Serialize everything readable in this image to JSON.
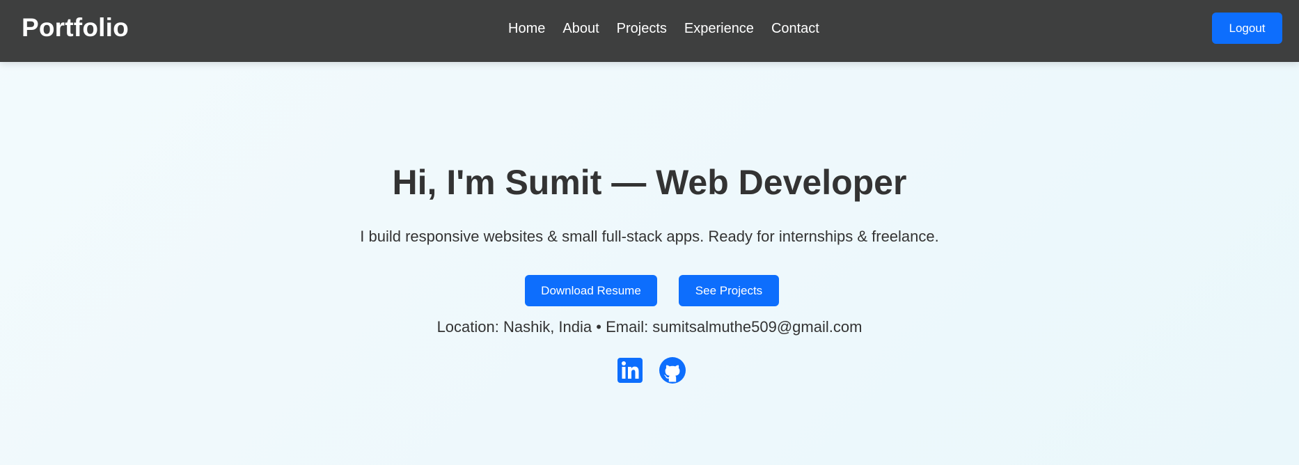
{
  "header": {
    "brand": "Portfolio",
    "nav": [
      {
        "label": "Home"
      },
      {
        "label": "About"
      },
      {
        "label": "Projects"
      },
      {
        "label": "Experience"
      },
      {
        "label": "Contact"
      }
    ],
    "logout_label": "Logout"
  },
  "hero": {
    "title": "Hi, I'm Sumit — Web Developer",
    "subtitle": "I build responsive websites & small full-stack apps. Ready for internships & freelance.",
    "buttons": {
      "download_resume": "Download Resume",
      "see_projects": "See Projects"
    },
    "contact_line": "Location: Nashik, India • Email: sumitsalmuthe509@gmail.com",
    "social": [
      {
        "icon": "linkedin-icon"
      },
      {
        "icon": "github-icon"
      }
    ]
  },
  "colors": {
    "navbar_bg": "#3e3f3f",
    "accent": "#0d6efd",
    "text": "#333333",
    "page_bg": "#eef8fc"
  }
}
